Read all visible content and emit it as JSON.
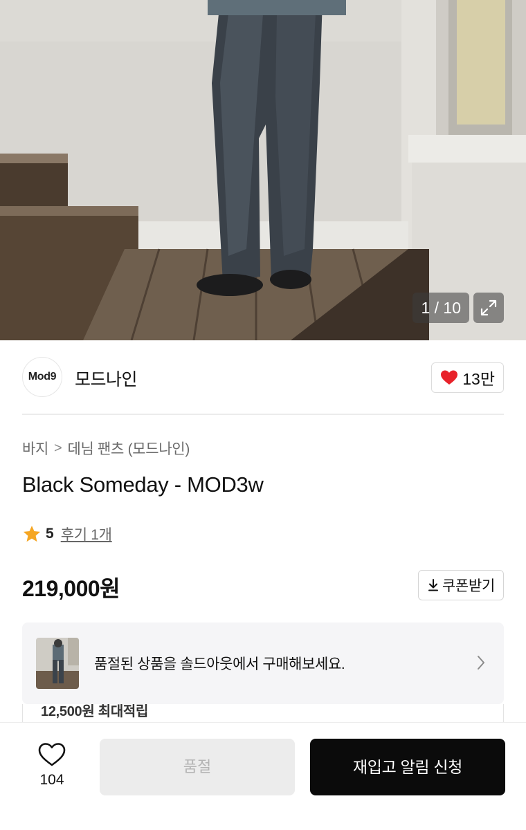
{
  "gallery": {
    "counter": "1 / 10",
    "photo_icon": "product-photo",
    "expand_icon": "expand-icon"
  },
  "shop": {
    "logo_text": "Mod9",
    "name": "모드나인",
    "like_count": "13만",
    "like_color": "#e8222a"
  },
  "breadcrumb": {
    "category": "바지",
    "separator": ">",
    "subcategory": "데님 팬츠 (모드나인)"
  },
  "product": {
    "title": "Black Someday - MOD3w",
    "rating": "5",
    "reviews": "후기 1개",
    "price": "219,000원"
  },
  "coupon": {
    "icon": "download-icon",
    "label": "쿠폰받기"
  },
  "promo": {
    "text": "품절된 상품을 솔드아웃에서 구매해보세요.",
    "points_partial": "12,500원 최대적립"
  },
  "bottom": {
    "wish_count": "104",
    "soldout_label": "품절",
    "restock_label": "재입고 알림 신청"
  },
  "colors": {
    "accent_black": "#0b0b0b",
    "star": "#f5a623",
    "disabled_bg": "#ececec"
  }
}
